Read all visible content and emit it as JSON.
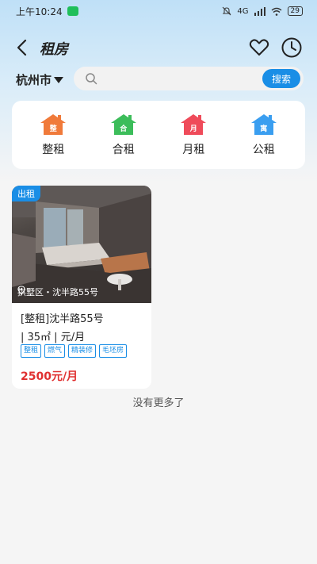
{
  "status_bar": {
    "time": "上午10:24",
    "signal_text": "4G",
    "battery": "29"
  },
  "header": {
    "title": "租房"
  },
  "city": {
    "name": "杭州市"
  },
  "search": {
    "placeholder": "",
    "button_label": "搜索"
  },
  "categories": [
    {
      "label": "整租",
      "icon_char": "整",
      "color": "#f07a3a"
    },
    {
      "label": "合租",
      "icon_char": "合",
      "color": "#3cbd5a"
    },
    {
      "label": "月租",
      "icon_char": "月",
      "color": "#ef4b5a"
    },
    {
      "label": "公租",
      "icon_char": "寓",
      "color": "#3a9ef0"
    }
  ],
  "listing": {
    "badge": "出租",
    "location": "拱墅区・沈半路55号",
    "title": "[整租]沈半路55号",
    "spec": "| 35㎡ | 元/月",
    "tags": [
      "整租",
      "燃气",
      "精装修",
      "毛坯房"
    ],
    "price": "2500元/月"
  },
  "footer_note": "没有更多了",
  "colors": {
    "accent": "#1a8ee6",
    "price": "#e03030"
  }
}
